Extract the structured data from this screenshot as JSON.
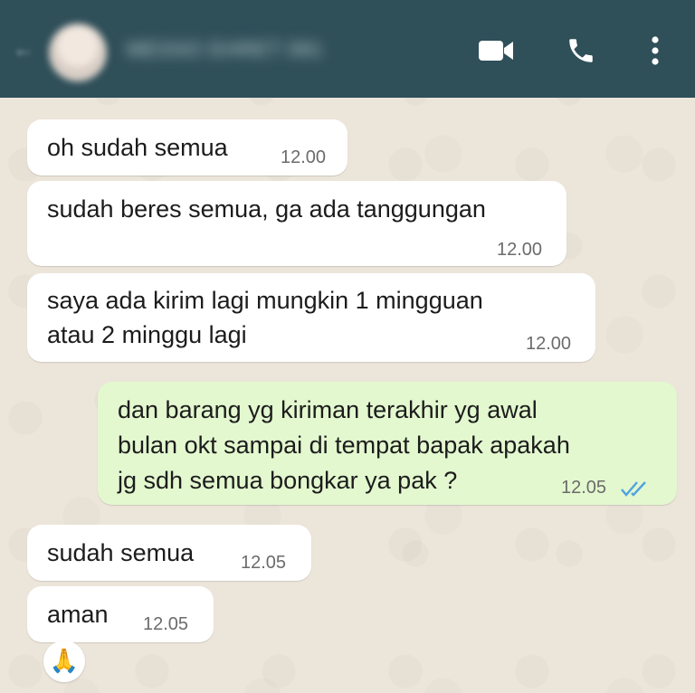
{
  "header": {
    "contact_name": "MESSO EHRET 081",
    "back_icon": "arrow-back-icon",
    "video_icon": "video-call-icon",
    "call_icon": "phone-icon",
    "menu_icon": "more-vertical-icon",
    "background_color": "#2f4f59"
  },
  "messages": [
    {
      "direction": "incoming",
      "lines": [
        "oh sudah semua"
      ],
      "time": "12.00"
    },
    {
      "direction": "incoming",
      "lines": [
        "sudah beres semua, ga ada tanggungan"
      ],
      "time": "12.00"
    },
    {
      "direction": "incoming",
      "lines": [
        "saya ada kirim lagi mungkin 1 mingguan",
        "atau 2 minggu lagi"
      ],
      "time": "12.00"
    },
    {
      "direction": "outgoing",
      "lines": [
        "dan barang yg kiriman terakhir yg awal",
        "bulan okt sampai di tempat bapak apakah",
        "jg sdh semua bongkar ya pak ?"
      ],
      "time": "12.05",
      "status": "read-double-check-icon"
    },
    {
      "direction": "incoming",
      "lines": [
        "sudah semua"
      ],
      "time": "12.05"
    },
    {
      "direction": "incoming",
      "lines": [
        "aman"
      ],
      "time": "12.05"
    }
  ],
  "reaction": {
    "emoji": "🙏",
    "name": "folded-hands-icon"
  },
  "colors": {
    "incoming_bubble": "#ffffff",
    "outgoing_bubble": "#e3f8cf",
    "read_ticks": "#4fa3e0",
    "chat_background": "#ece5da"
  }
}
